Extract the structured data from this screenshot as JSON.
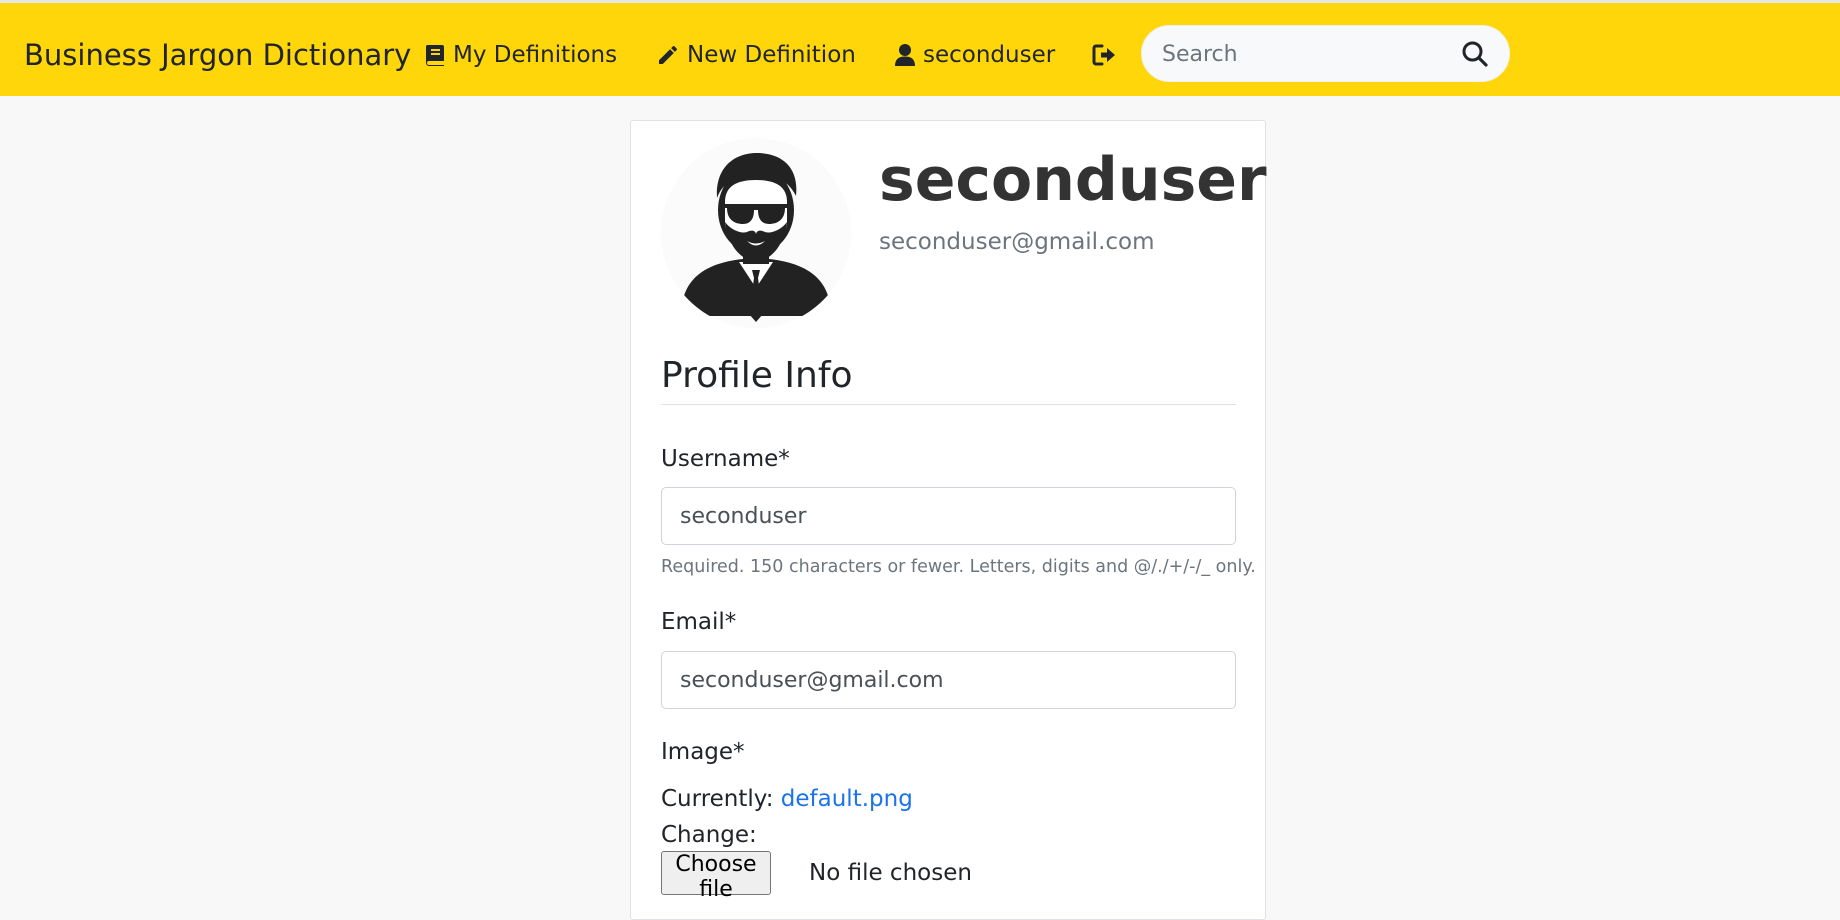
{
  "navbar": {
    "brand": "Business Jargon Dictionary",
    "my_definitions": "My Definitions",
    "new_definition": "New Definition",
    "username": "seconduser",
    "search_placeholder": "Search",
    "background_color": "#ffd60a"
  },
  "icons": {
    "my_definitions": "book-icon",
    "new_definition": "pencil-icon",
    "username": "user-icon",
    "logout": "logout-icon",
    "search": "search-icon"
  },
  "profile": {
    "name": "seconduser",
    "email": "seconduser@gmail.com"
  },
  "form": {
    "legend": "Profile Info",
    "username_label": "Username*",
    "username_value": "seconduser",
    "username_help": "Required. 150 characters or fewer. Letters, digits and @/./+/-/_ only.",
    "email_label": "Email*",
    "email_value": "seconduser@gmail.com",
    "image_label": "Image*",
    "currently_label": "Currently:",
    "current_image": "default.png",
    "change_label": "Change:",
    "choose_file_label": "Choose file",
    "file_status": "No file chosen"
  }
}
